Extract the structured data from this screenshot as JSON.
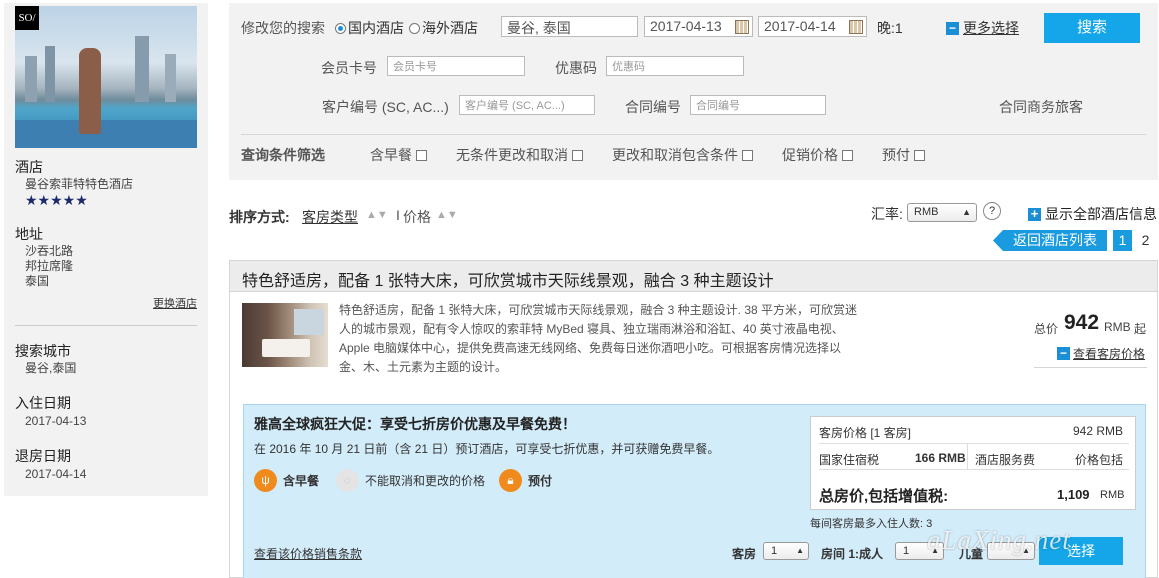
{
  "sidebar": {
    "logo": "SO/",
    "hotel_label": "酒店",
    "hotel_name": "曼谷索菲特特色酒店",
    "stars": "★★★★★",
    "address_label": "地址",
    "address_lines": [
      "沙吞北路",
      "邦拉席隆",
      "泰国"
    ],
    "change_hotel": "更换酒店",
    "city_label": "搜索城市",
    "city_value": "曼谷,泰国",
    "checkin_label": "入住日期",
    "checkin_value": "2017-04-13",
    "checkout_label": "退房日期",
    "checkout_value": "2017-04-14"
  },
  "search": {
    "modify_label": "修改您的搜索",
    "radio_domestic": "国内酒店",
    "radio_overseas": "海外酒店",
    "destination": "曼谷, 泰国",
    "checkin": "2017-04-13",
    "checkout": "2017-04-14",
    "nights": "晚:1",
    "more_options": "更多选择",
    "search_button": "搜索",
    "member_label": "会员卡号",
    "member_placeholder": "会员卡号",
    "promo_label": "优惠码",
    "promo_placeholder": "优惠码",
    "client_label": "客户编号 (SC, AC...)",
    "client_placeholder": "客户编号 (SC, AC...)",
    "contract_label": "合同编号",
    "contract_placeholder": "合同编号",
    "contract_traveler": "合同商务旅客",
    "filter_title": "查询条件筛选",
    "filters": [
      "含早餐",
      "无条件更改和取消",
      "更改和取消包含条件",
      "促销价格",
      "预付"
    ]
  },
  "sort": {
    "label": "排序方式:",
    "room_type": "客房类型",
    "arrows": "▲▼",
    "separator": "I",
    "price": "价格",
    "rate_label": "汇率:",
    "currency": "RMB",
    "help": "?",
    "show_all": "显示全部酒店信息",
    "back": "返回酒店列表",
    "page1": "1",
    "page2": "2"
  },
  "room": {
    "title": "特色舒适房，配备 1 张特大床，可欣赏城市天际线景观，融合 3 种主题设计",
    "description": "特色舒适房，配备 1 张特大床，可欣赏城市天际线景观，融合 3 种主题设计. 38 平方米，可欣赏迷人的城市景观，配有令人惊叹的索菲特 MyBed 寝具、独立瑞雨淋浴和浴缸、40 英寸液晶电视、Apple 电脑媒体中心，提供免费高速无线网络、免费每日迷你酒吧小吃。可根据客房情况选择以金、木、土元素为主题的设计。",
    "total_label": "总价",
    "total_amount": "942",
    "total_unit": "RMB",
    "total_qi": "起",
    "view_rates": "查看客房价格"
  },
  "promo": {
    "title": "雅高全球疯狂大促：享受七折房价优惠及早餐免费！",
    "text": "在 2016 年 10 月 21 日前（含 21 日）预订酒店，可享受七折优惠，并可获赠免费早餐。",
    "amenity_breakfast": "含早餐",
    "amenity_nocancel": "不能取消和更改的价格",
    "amenity_prepay": "预付",
    "terms_link": "查看该价格销售条款",
    "price_label": "客房价格 [1 客房]",
    "price_value": "942 RMB",
    "tax_label": "国家住宿税",
    "tax_value": "166 RMB",
    "service_label": "酒店服务费",
    "service_value": "价格包括",
    "total_label": "总房价,包括增值税:",
    "total_value": "1,109",
    "total_unit": "RMB",
    "max_guests": "每间客房最多入住人数: 3",
    "rooms_label": "客房",
    "rooms_value": "1",
    "adults_label": "房间 1:成人",
    "adults_value": "1",
    "children_label": "儿童",
    "select_button": "选择"
  },
  "watermark": "aLaXing.net",
  "colors": {
    "accent_blue": "#14a6e8",
    "amenity_orange": "#f08a1c",
    "promo_bg": "#d3ecfa",
    "panel_grey": "#f2f2f2"
  }
}
